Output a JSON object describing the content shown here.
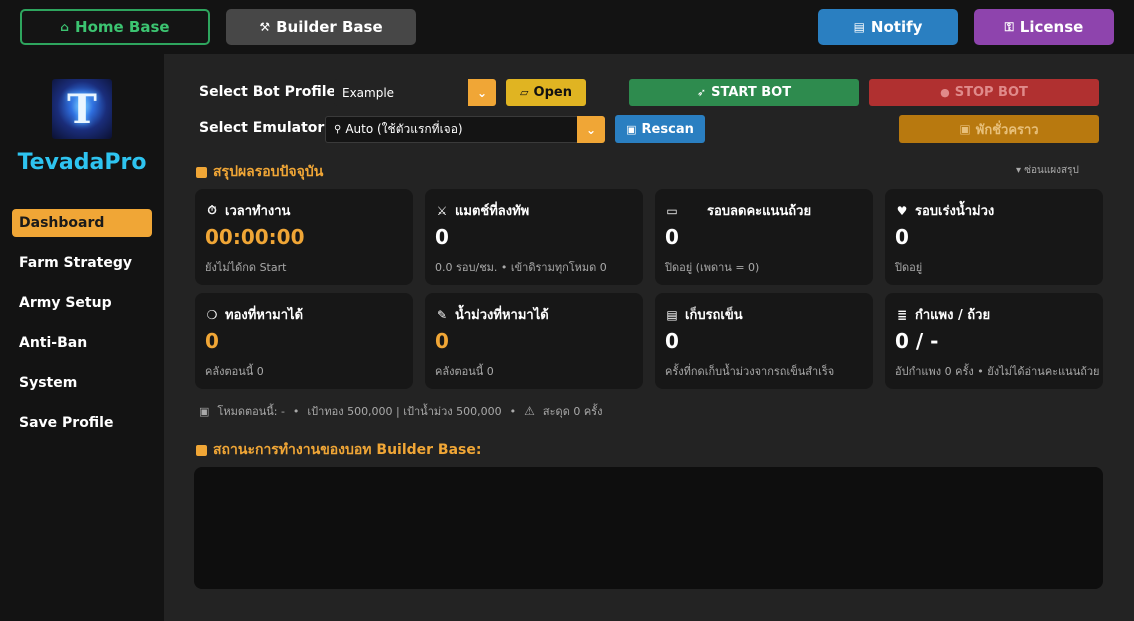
{
  "topbar": {
    "home_base": "Home Base",
    "builder_base": "Builder Base",
    "notify": "Notify",
    "license": "License"
  },
  "sidebar": {
    "brand": "TevadaPro",
    "items": [
      {
        "label": "Dashboard"
      },
      {
        "label": "Farm Strategy"
      },
      {
        "label": "Army Setup"
      },
      {
        "label": "Anti-Ban"
      },
      {
        "label": "System"
      },
      {
        "label": "Save Profile"
      }
    ]
  },
  "controls": {
    "profile_label": "Select Bot Profile:",
    "profile_value": "Example",
    "open_button": "Open",
    "start_button": "START BOT",
    "stop_button": "STOP BOT",
    "emulator_label": "Select Emulator:",
    "emulator_value": "Auto (ใช้ตัวแรกที่เจอ)",
    "rescan_button": "Rescan",
    "pause_button": "พักชั่วคราว"
  },
  "summary": {
    "title": "สรุปผลรอบปัจจุบัน",
    "collapse": "▾ ซ่อนแผงสรุป",
    "cards": [
      {
        "title": "เวลาทำงาน",
        "value": "00:00:00",
        "sub": "ยังไม่ได้กด Start"
      },
      {
        "title": "แมตช์ที่ลงทัพ",
        "value": "0",
        "sub": "0.0 รอบ/ชม. • เข้าดิรามทุกโหมด 0"
      },
      {
        "title": "รอบลดคะแนนถ้วย",
        "value": "0",
        "sub": "ปิดอยู่ (เพดาน = 0)"
      },
      {
        "title": "รอบเร่งน้ำม่วง",
        "value": "0",
        "sub": "ปิดอยู่"
      },
      {
        "title": "ทองที่หามาได้",
        "value": "0",
        "sub": "คลังตอนนี้ 0"
      },
      {
        "title": "น้ำม่วงที่หามาได้",
        "value": "0",
        "sub": "คลังตอนนี้ 0"
      },
      {
        "title": "เก็บรถเข็น",
        "value": "0",
        "sub": "ครั้งที่กดเก็บน้ำม่วงจากรถเข็นสำเร็จ"
      },
      {
        "title": "กำแพง / ถ้วย",
        "value": "0 / -",
        "sub": "อัปกำแพง 0 ครั้ง • ยังไม่ได้อ่านคะแนนถ้วย"
      }
    ],
    "status_mode": "โหมดตอนนี้: -",
    "status_targets": "เป้าทอง 500,000 | เป้าน้ำม่วง 500,000",
    "status_stuck": "สะดุด 0 ครั้ง"
  },
  "log": {
    "title": "สถานะการทำงานของบอท Builder Base:"
  },
  "colors": {
    "accent": "#f0a636",
    "home_green": "#2ea55e",
    "start_green": "#2e8b4e",
    "stop_red": "#b03030",
    "notify_blue": "#2a7fc1",
    "license_purple": "#8e44ad",
    "brand_cyan": "#2ec4f0"
  }
}
